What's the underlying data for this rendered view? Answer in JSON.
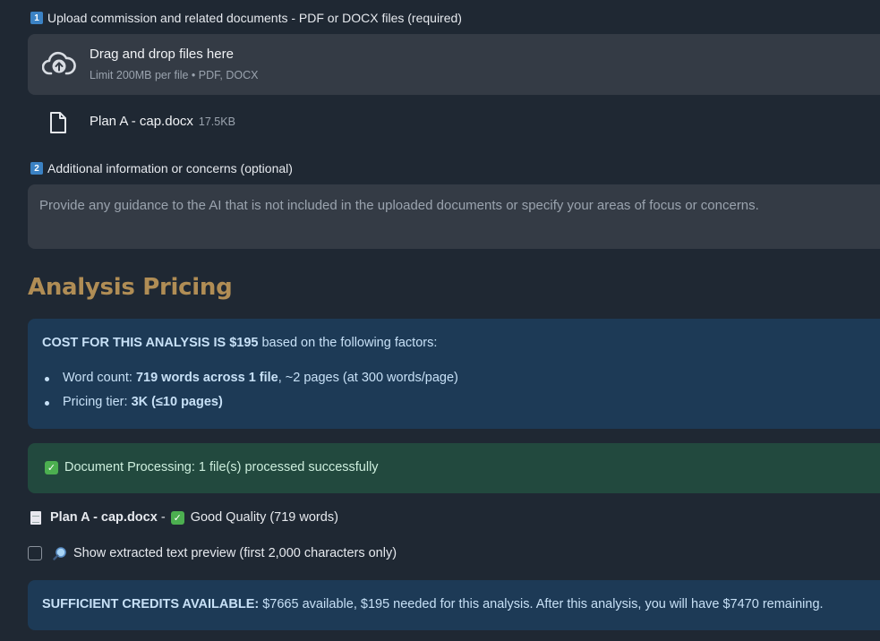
{
  "upload": {
    "step_number": "1",
    "label": "Upload commission and related documents - PDF or DOCX files (required)",
    "dropzone_title": "Drag and drop files here",
    "dropzone_subtitle": "Limit 200MB per file • PDF, DOCX",
    "file": {
      "name": "Plan A - cap.docx",
      "size": "17.5KB"
    }
  },
  "additional": {
    "step_number": "2",
    "label": "Additional information or concerns (optional)",
    "placeholder": "Provide any guidance to the AI that is not included in the uploaded documents or specify your areas of focus or concerns."
  },
  "pricing": {
    "heading": "Analysis Pricing",
    "cost_bold": "COST FOR THIS ANALYSIS IS $195",
    "cost_rest": " based on the following factors:",
    "items": [
      {
        "prefix": "Word count: ",
        "bold": "719 words across 1 file",
        "rest": ", ~2 pages (at 300 words/page)"
      },
      {
        "prefix": "Pricing tier: ",
        "bold": "3K (≤10 pages)",
        "rest": ""
      }
    ]
  },
  "processing": {
    "message": "Document Processing: 1 file(s) processed successfully"
  },
  "quality": {
    "file_name": "Plan A - cap.docx",
    "separator": " - ",
    "status": "Good Quality (719 words)"
  },
  "preview_toggle": {
    "label": "Show extracted text preview (first 2,000 characters only)",
    "checked": false
  },
  "credits": {
    "bold": "SUFFICIENT CREDITS AVAILABLE:",
    "rest": " $7665 available, $195 needed for this analysis. After this analysis, you will have $7470 remaining."
  },
  "colors": {
    "background": "#1f2833",
    "heading": "#b08d55",
    "info_bg": "#1d3a56",
    "success_bg": "#22493e",
    "input_bg": "#343b45"
  }
}
